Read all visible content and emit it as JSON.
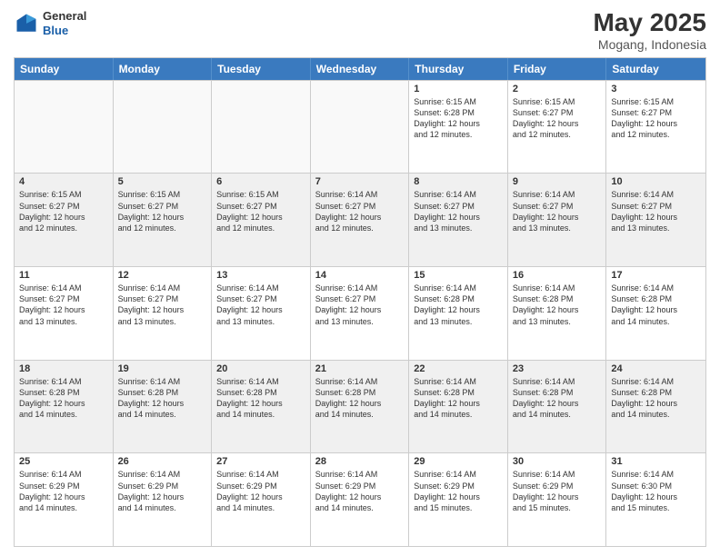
{
  "header": {
    "logo_general": "General",
    "logo_blue": "Blue",
    "title": "May 2025",
    "location": "Mogang, Indonesia"
  },
  "days_of_week": [
    "Sunday",
    "Monday",
    "Tuesday",
    "Wednesday",
    "Thursday",
    "Friday",
    "Saturday"
  ],
  "weeks": [
    [
      {
        "day": "",
        "detail": "",
        "empty": true
      },
      {
        "day": "",
        "detail": "",
        "empty": true
      },
      {
        "day": "",
        "detail": "",
        "empty": true
      },
      {
        "day": "",
        "detail": "",
        "empty": true
      },
      {
        "day": "1",
        "detail": "Sunrise: 6:15 AM\nSunset: 6:28 PM\nDaylight: 12 hours\nand 12 minutes.",
        "empty": false
      },
      {
        "day": "2",
        "detail": "Sunrise: 6:15 AM\nSunset: 6:27 PM\nDaylight: 12 hours\nand 12 minutes.",
        "empty": false
      },
      {
        "day": "3",
        "detail": "Sunrise: 6:15 AM\nSunset: 6:27 PM\nDaylight: 12 hours\nand 12 minutes.",
        "empty": false
      }
    ],
    [
      {
        "day": "4",
        "detail": "Sunrise: 6:15 AM\nSunset: 6:27 PM\nDaylight: 12 hours\nand 12 minutes.",
        "empty": false
      },
      {
        "day": "5",
        "detail": "Sunrise: 6:15 AM\nSunset: 6:27 PM\nDaylight: 12 hours\nand 12 minutes.",
        "empty": false
      },
      {
        "day": "6",
        "detail": "Sunrise: 6:15 AM\nSunset: 6:27 PM\nDaylight: 12 hours\nand 12 minutes.",
        "empty": false
      },
      {
        "day": "7",
        "detail": "Sunrise: 6:14 AM\nSunset: 6:27 PM\nDaylight: 12 hours\nand 12 minutes.",
        "empty": false
      },
      {
        "day": "8",
        "detail": "Sunrise: 6:14 AM\nSunset: 6:27 PM\nDaylight: 12 hours\nand 13 minutes.",
        "empty": false
      },
      {
        "day": "9",
        "detail": "Sunrise: 6:14 AM\nSunset: 6:27 PM\nDaylight: 12 hours\nand 13 minutes.",
        "empty": false
      },
      {
        "day": "10",
        "detail": "Sunrise: 6:14 AM\nSunset: 6:27 PM\nDaylight: 12 hours\nand 13 minutes.",
        "empty": false
      }
    ],
    [
      {
        "day": "11",
        "detail": "Sunrise: 6:14 AM\nSunset: 6:27 PM\nDaylight: 12 hours\nand 13 minutes.",
        "empty": false
      },
      {
        "day": "12",
        "detail": "Sunrise: 6:14 AM\nSunset: 6:27 PM\nDaylight: 12 hours\nand 13 minutes.",
        "empty": false
      },
      {
        "day": "13",
        "detail": "Sunrise: 6:14 AM\nSunset: 6:27 PM\nDaylight: 12 hours\nand 13 minutes.",
        "empty": false
      },
      {
        "day": "14",
        "detail": "Sunrise: 6:14 AM\nSunset: 6:27 PM\nDaylight: 12 hours\nand 13 minutes.",
        "empty": false
      },
      {
        "day": "15",
        "detail": "Sunrise: 6:14 AM\nSunset: 6:28 PM\nDaylight: 12 hours\nand 13 minutes.",
        "empty": false
      },
      {
        "day": "16",
        "detail": "Sunrise: 6:14 AM\nSunset: 6:28 PM\nDaylight: 12 hours\nand 13 minutes.",
        "empty": false
      },
      {
        "day": "17",
        "detail": "Sunrise: 6:14 AM\nSunset: 6:28 PM\nDaylight: 12 hours\nand 14 minutes.",
        "empty": false
      }
    ],
    [
      {
        "day": "18",
        "detail": "Sunrise: 6:14 AM\nSunset: 6:28 PM\nDaylight: 12 hours\nand 14 minutes.",
        "empty": false
      },
      {
        "day": "19",
        "detail": "Sunrise: 6:14 AM\nSunset: 6:28 PM\nDaylight: 12 hours\nand 14 minutes.",
        "empty": false
      },
      {
        "day": "20",
        "detail": "Sunrise: 6:14 AM\nSunset: 6:28 PM\nDaylight: 12 hours\nand 14 minutes.",
        "empty": false
      },
      {
        "day": "21",
        "detail": "Sunrise: 6:14 AM\nSunset: 6:28 PM\nDaylight: 12 hours\nand 14 minutes.",
        "empty": false
      },
      {
        "day": "22",
        "detail": "Sunrise: 6:14 AM\nSunset: 6:28 PM\nDaylight: 12 hours\nand 14 minutes.",
        "empty": false
      },
      {
        "day": "23",
        "detail": "Sunrise: 6:14 AM\nSunset: 6:28 PM\nDaylight: 12 hours\nand 14 minutes.",
        "empty": false
      },
      {
        "day": "24",
        "detail": "Sunrise: 6:14 AM\nSunset: 6:28 PM\nDaylight: 12 hours\nand 14 minutes.",
        "empty": false
      }
    ],
    [
      {
        "day": "25",
        "detail": "Sunrise: 6:14 AM\nSunset: 6:29 PM\nDaylight: 12 hours\nand 14 minutes.",
        "empty": false
      },
      {
        "day": "26",
        "detail": "Sunrise: 6:14 AM\nSunset: 6:29 PM\nDaylight: 12 hours\nand 14 minutes.",
        "empty": false
      },
      {
        "day": "27",
        "detail": "Sunrise: 6:14 AM\nSunset: 6:29 PM\nDaylight: 12 hours\nand 14 minutes.",
        "empty": false
      },
      {
        "day": "28",
        "detail": "Sunrise: 6:14 AM\nSunset: 6:29 PM\nDaylight: 12 hours\nand 14 minutes.",
        "empty": false
      },
      {
        "day": "29",
        "detail": "Sunrise: 6:14 AM\nSunset: 6:29 PM\nDaylight: 12 hours\nand 15 minutes.",
        "empty": false
      },
      {
        "day": "30",
        "detail": "Sunrise: 6:14 AM\nSunset: 6:29 PM\nDaylight: 12 hours\nand 15 minutes.",
        "empty": false
      },
      {
        "day": "31",
        "detail": "Sunrise: 6:14 AM\nSunset: 6:30 PM\nDaylight: 12 hours\nand 15 minutes.",
        "empty": false
      }
    ]
  ]
}
